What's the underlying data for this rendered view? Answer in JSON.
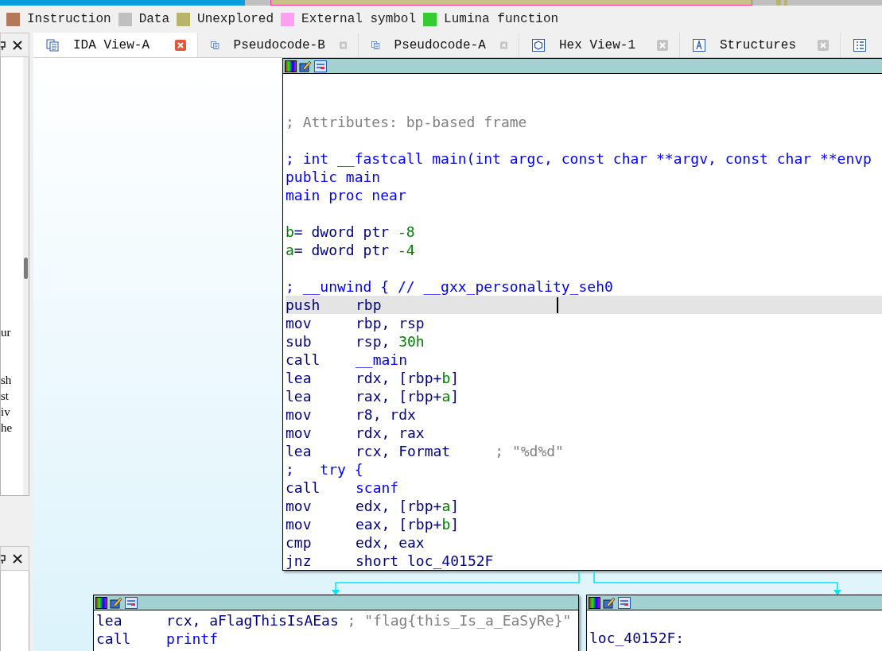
{
  "legend": [
    {
      "label": "Instruction",
      "color": "#b5785a"
    },
    {
      "label": "Data",
      "color": "#c0c0c0"
    },
    {
      "label": "Unexplored",
      "color": "#b8b46c"
    },
    {
      "label": "External symbol",
      "color": "#ffa0f0"
    },
    {
      "label": "Lumina function",
      "color": "#33cc33"
    }
  ],
  "side_panel": {
    "lines": [
      {
        "text": "ur",
        "space_before": false
      },
      {
        "text": "sh",
        "space_before": true
      },
      {
        "text": "st",
        "space_before": false
      },
      {
        "text": "iv",
        "space_before": false
      },
      {
        "text": "he",
        "space_before": false
      }
    ]
  },
  "tabs": [
    {
      "label": "IDA View-A",
      "kind": "listing",
      "selected": true
    },
    {
      "label": "Pseudocode-B",
      "kind": "listing",
      "selected": false
    },
    {
      "label": "Pseudocode-A",
      "kind": "listing",
      "selected": false
    },
    {
      "label": "Hex View-1",
      "kind": "hex",
      "selected": false
    },
    {
      "label": "Structures",
      "kind": "struct",
      "selected": false
    },
    {
      "kind": "list",
      "selected": false
    }
  ],
  "graph": {
    "nodes": [
      {
        "lines": [
          {
            "parts": [
              {
                "text": "; Attributes: bp-based frame",
                "kind": "comment"
              }
            ],
            "space_before": false,
            "selected": false
          },
          {
            "parts": [
              {
                "text": "; int __fastcall main(int argc, const char **argv, const char **envp",
                "kind": "name"
              }
            ],
            "space_before": true,
            "selected": false
          },
          {
            "parts": [
              {
                "text": "public main",
                "kind": "name"
              }
            ],
            "space_before": false,
            "selected": false
          },
          {
            "parts": [
              {
                "text": "main proc near",
                "kind": "name"
              }
            ],
            "space_before": false,
            "selected": false
          },
          {
            "parts": [
              {
                "text": "b",
                "kind": "var"
              },
              {
                "text": "= dword ptr ",
                "kind": "code"
              },
              {
                "text": "-8",
                "kind": "num"
              }
            ],
            "space_before": true,
            "selected": false
          },
          {
            "parts": [
              {
                "text": "a",
                "kind": "var"
              },
              {
                "text": "= dword ptr ",
                "kind": "code"
              },
              {
                "text": "-4",
                "kind": "num"
              }
            ],
            "space_before": false,
            "selected": false
          },
          {
            "parts": [
              {
                "text": "; __unwind { // __gxx_personality_seh0",
                "kind": "name"
              }
            ],
            "space_before": true,
            "selected": false
          },
          {
            "parts": [
              {
                "text": "push",
                "kind": "mnemonic"
              },
              {
                "text": "rbp",
                "kind": "code"
              }
            ],
            "space_before": false,
            "selected": true
          },
          {
            "parts": [
              {
                "text": "mov",
                "kind": "mnemonic"
              },
              {
                "text": "rbp, rsp",
                "kind": "code"
              }
            ],
            "space_before": false,
            "selected": false
          },
          {
            "parts": [
              {
                "text": "sub",
                "kind": "mnemonic"
              },
              {
                "text": "rsp, ",
                "kind": "code"
              },
              {
                "text": "30h",
                "kind": "num"
              }
            ],
            "space_before": false,
            "selected": false
          },
          {
            "parts": [
              {
                "text": "call",
                "kind": "mnemonic"
              },
              {
                "text": "__main",
                "kind": "name"
              }
            ],
            "space_before": false,
            "selected": false
          },
          {
            "parts": [
              {
                "text": "lea",
                "kind": "mnemonic"
              },
              {
                "text": "rdx, [rbp+",
                "kind": "code"
              },
              {
                "text": "b",
                "kind": "var"
              },
              {
                "text": "]",
                "kind": "code"
              }
            ],
            "space_before": false,
            "selected": false
          },
          {
            "parts": [
              {
                "text": "lea",
                "kind": "mnemonic"
              },
              {
                "text": "rax, [rbp+",
                "kind": "code"
              },
              {
                "text": "a",
                "kind": "var"
              },
              {
                "text": "]",
                "kind": "code"
              }
            ],
            "space_before": false,
            "selected": false
          },
          {
            "parts": [
              {
                "text": "mov",
                "kind": "mnemonic"
              },
              {
                "text": "r8, rdx",
                "kind": "code"
              }
            ],
            "space_before": false,
            "selected": false
          },
          {
            "parts": [
              {
                "text": "mov",
                "kind": "mnemonic"
              },
              {
                "text": "rdx, rax",
                "kind": "code"
              }
            ],
            "space_before": false,
            "selected": false
          },
          {
            "parts": [
              {
                "text": "lea",
                "kind": "mnemonic"
              },
              {
                "text": "rcx, Format",
                "kind": "code"
              },
              {
                "text": "; \"%d%d\"",
                "kind": "comment_col"
              }
            ],
            "space_before": false,
            "selected": false
          },
          {
            "parts": [
              {
                "text": ";   try {",
                "kind": "name"
              }
            ],
            "space_before": false,
            "selected": false
          },
          {
            "parts": [
              {
                "text": "call",
                "kind": "mnemonic"
              },
              {
                "text": "scanf",
                "kind": "name"
              }
            ],
            "space_before": false,
            "selected": false
          },
          {
            "parts": [
              {
                "text": "mov",
                "kind": "mnemonic"
              },
              {
                "text": "edx, [rbp+",
                "kind": "code"
              },
              {
                "text": "a",
                "kind": "var"
              },
              {
                "text": "]",
                "kind": "code"
              }
            ],
            "space_before": false,
            "selected": false
          },
          {
            "parts": [
              {
                "text": "mov",
                "kind": "mnemonic"
              },
              {
                "text": "eax, [rbp+",
                "kind": "code"
              },
              {
                "text": "b",
                "kind": "var"
              },
              {
                "text": "]",
                "kind": "code"
              }
            ],
            "space_before": false,
            "selected": false
          },
          {
            "parts": [
              {
                "text": "cmp",
                "kind": "mnemonic"
              },
              {
                "text": "edx, eax",
                "kind": "code"
              }
            ],
            "space_before": false,
            "selected": false
          },
          {
            "parts": [
              {
                "text": "jnz",
                "kind": "mnemonic"
              },
              {
                "text": "short loc_40152F",
                "kind": "code"
              }
            ],
            "space_before": false,
            "selected": false
          }
        ]
      },
      {
        "lines": [
          {
            "parts": [
              {
                "text": "lea",
                "kind": "mnemonic"
              },
              {
                "text": "rcx, aFlagThisIsAEas",
                "kind": "code"
              },
              {
                "text": " ; \"flag{this_Is_a_EaSyRe}\"",
                "kind": "comment"
              }
            ],
            "space_before": false,
            "selected": false
          },
          {
            "parts": [
              {
                "text": "call",
                "kind": "mnemonic"
              },
              {
                "text": "printf",
                "kind": "name"
              }
            ],
            "space_before": false,
            "selected": false
          }
        ]
      },
      {
        "lines": [
          {
            "parts": [
              {
                "text": "loc_40152F:",
                "kind": "code"
              }
            ],
            "space_before": true,
            "selected": false
          }
        ]
      }
    ]
  }
}
